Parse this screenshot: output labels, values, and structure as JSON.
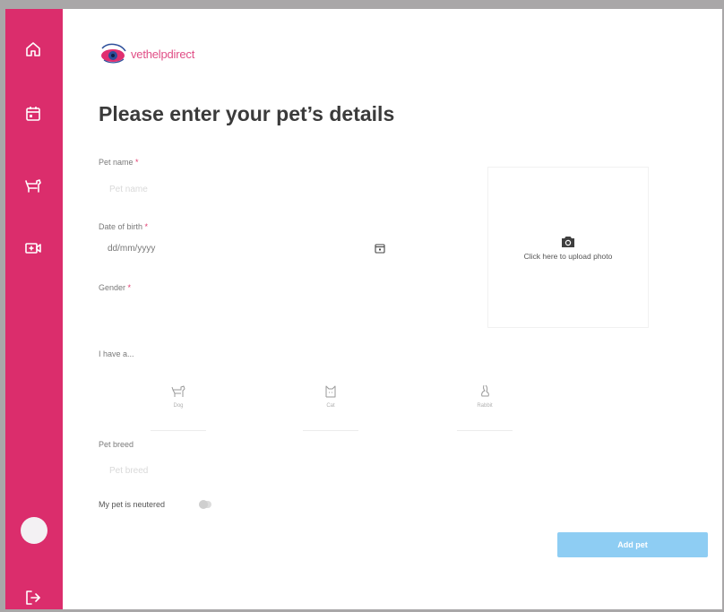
{
  "brand": {
    "logo_text": "vethelpdirect",
    "accent": "#db2d6c",
    "button_color": "#8ecdf3"
  },
  "sidebar": {
    "items": [
      {
        "icon": "home-icon"
      },
      {
        "icon": "calendar-icon"
      },
      {
        "icon": "pet-icon"
      },
      {
        "icon": "video-call-icon"
      }
    ],
    "logout_icon": "logout-icon"
  },
  "form": {
    "title": "Please enter your pet’s details",
    "pet_name_label": "Pet name",
    "pet_name_placeholder": "Pet name",
    "dob_label": "Date of birth",
    "dob_value": "dd/mm/yyyy",
    "gender_label": "Gender",
    "required_mark": "*",
    "upload_text": "Click here to upload photo",
    "have_a_label": "I have a...",
    "pet_types": [
      {
        "label": "Dog",
        "icon": "dog-icon"
      },
      {
        "label": "Cat",
        "icon": "cat-icon"
      },
      {
        "label": "Rabbit",
        "icon": "rabbit-icon"
      }
    ],
    "breed_label": "Pet breed",
    "breed_placeholder": "Pet breed",
    "neutered_label": "My pet is neutered",
    "neutered_value": false,
    "submit_label": "Add pet"
  }
}
